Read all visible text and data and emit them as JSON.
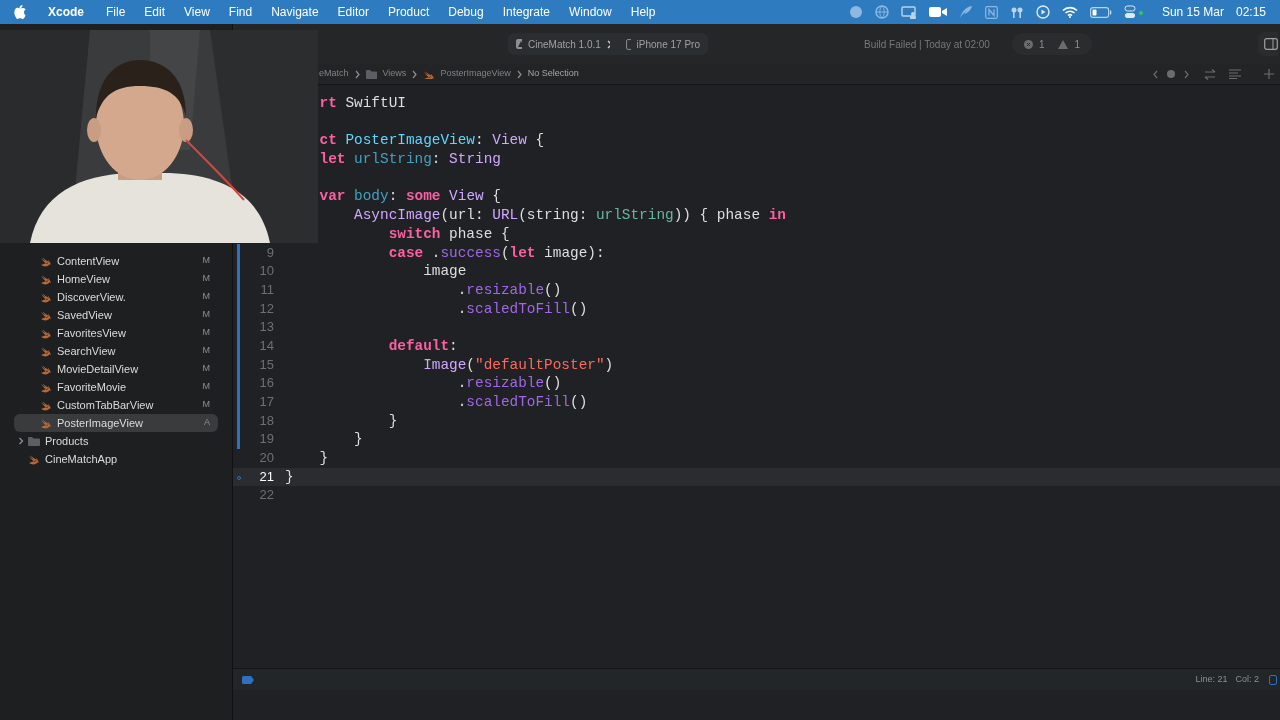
{
  "menu_bar": {
    "app_name": "Xcode",
    "menus": [
      "File",
      "Edit",
      "View",
      "Find",
      "Navigate",
      "Editor",
      "Product",
      "Debug",
      "Integrate",
      "Window",
      "Help"
    ],
    "date": "Sun 15 Mar",
    "time": "02:15"
  },
  "toolbar": {
    "scheme": "CineMatch 1.0.1",
    "device": "iPhone 17 Pro",
    "build_status": "Build Failed | Today at 02:00",
    "errors": "1",
    "warnings": "1"
  },
  "navigator": {
    "items": [
      {
        "children": [
          {
            "name": "ContentView",
            "kind": "swift",
            "badge": "M",
            "selected": false
          },
          {
            "name": "HomeView",
            "kind": "swift",
            "badge": "M",
            "selected": false
          },
          {
            "name": "DiscoverView.",
            "kind": "swift",
            "badge": "M",
            "selected": false
          },
          {
            "name": "SavedView",
            "kind": "swift",
            "badge": "M",
            "selected": false
          },
          {
            "name": "FavoritesView",
            "kind": "swift",
            "badge": "M",
            "selected": false
          },
          {
            "name": "SearchView",
            "kind": "swift",
            "badge": "M",
            "selected": false
          },
          {
            "name": "MovieDetailView",
            "kind": "swift",
            "badge": "M",
            "selected": false
          },
          {
            "name": "FavoriteMovie",
            "kind": "swift",
            "badge": "M",
            "selected": false
          },
          {
            "name": "CustomTabBarView",
            "kind": "swift",
            "badge": "M",
            "selected": false
          },
          {
            "name": "PosterImageView",
            "kind": "swift",
            "badge": "A",
            "selected": true
          }
        ]
      },
      {
        "name": "Products",
        "kind": "folder",
        "expanded": false,
        "selected": false
      },
      {
        "name": "CineMatchApp",
        "kind": "swift",
        "selected": false
      }
    ]
  },
  "jump_bar": [
    {
      "text": "eMatch",
      "kind": "project"
    },
    {
      "text": "Views",
      "kind": "folder"
    },
    {
      "text": "PosterImageView",
      "kind": "swift"
    },
    {
      "text": "No Selection",
      "kind": "symbol"
    }
  ],
  "editor": {
    "lines": [
      {
        "kind": "code",
        "tokens": [
          {
            "kind": "keyword",
            "text": "    rt"
          },
          {
            "kind": "plain",
            "text": " SwiftUI"
          }
        ]
      },
      {
        "kind": "blank"
      },
      {
        "kind": "code",
        "tokens": [
          {
            "kind": "keyword",
            "text": "    ct "
          },
          {
            "kind": "decl_type",
            "text": "PosterImageView"
          },
          {
            "kind": "plain",
            "text": ": "
          },
          {
            "kind": "type",
            "text": "View"
          },
          {
            "kind": "plain",
            "text": " {"
          }
        ]
      },
      {
        "kind": "code",
        "tokens": [
          {
            "kind": "keyword",
            "text": "    let "
          },
          {
            "kind": "decl",
            "text": "urlString"
          },
          {
            "kind": "plain",
            "text": ": "
          },
          {
            "kind": "type",
            "text": "String"
          }
        ]
      },
      {
        "kind": "blank"
      },
      {
        "kind": "code",
        "tokens": [
          {
            "kind": "keyword",
            "text": "    var "
          },
          {
            "kind": "decl",
            "text": "body"
          },
          {
            "kind": "plain",
            "text": ": "
          },
          {
            "kind": "keyword",
            "text": "some "
          },
          {
            "kind": "type",
            "text": "View"
          },
          {
            "kind": "plain",
            "text": " {"
          }
        ]
      },
      {
        "kind": "code",
        "tokens": [
          {
            "kind": "type",
            "text": "        AsyncImage"
          },
          {
            "kind": "plain",
            "text": "(url: "
          },
          {
            "kind": "type",
            "text": "URL"
          },
          {
            "kind": "plain",
            "text": "(string: "
          },
          {
            "kind": "ref",
            "text": "urlString"
          },
          {
            "kind": "plain",
            "text": ")) { phase "
          },
          {
            "kind": "keyword",
            "text": "in"
          }
        ]
      },
      {
        "kind": "code",
        "tokens": [
          {
            "kind": "keyword",
            "text": "            switch"
          },
          {
            "kind": "plain",
            "text": " phase {"
          }
        ]
      },
      {
        "number": "9",
        "changed": true,
        "tokens": [
          {
            "kind": "keyword",
            "text": "            case"
          },
          {
            "kind": "plain",
            "text": " ."
          },
          {
            "kind": "member",
            "text": "success"
          },
          {
            "kind": "plain",
            "text": "("
          },
          {
            "kind": "keyword",
            "text": "let"
          },
          {
            "kind": "plain",
            "text": " image):"
          }
        ]
      },
      {
        "number": "10",
        "changed": true,
        "tokens": [
          {
            "kind": "plain",
            "text": "                image"
          }
        ]
      },
      {
        "number": "11",
        "changed": true,
        "tokens": [
          {
            "kind": "plain",
            "text": "                    ."
          },
          {
            "kind": "member",
            "text": "resizable"
          },
          {
            "kind": "plain",
            "text": "()"
          }
        ]
      },
      {
        "number": "12",
        "changed": true,
        "tokens": [
          {
            "kind": "plain",
            "text": "                    ."
          },
          {
            "kind": "member",
            "text": "scaledToFill"
          },
          {
            "kind": "plain",
            "text": "()"
          }
        ]
      },
      {
        "number": "13",
        "changed": true
      },
      {
        "number": "14",
        "changed": true,
        "tokens": [
          {
            "kind": "keyword",
            "text": "            default"
          },
          {
            "kind": "plain",
            "text": ":"
          }
        ]
      },
      {
        "number": "15",
        "changed": true,
        "tokens": [
          {
            "kind": "type",
            "text": "                Image"
          },
          {
            "kind": "plain",
            "text": "("
          },
          {
            "kind": "string",
            "text": "\"defaultPoster\""
          },
          {
            "kind": "plain",
            "text": ")"
          }
        ]
      },
      {
        "number": "16",
        "changed": true,
        "tokens": [
          {
            "kind": "plain",
            "text": "                    ."
          },
          {
            "kind": "member",
            "text": "resizable"
          },
          {
            "kind": "plain",
            "text": "()"
          }
        ]
      },
      {
        "number": "17",
        "changed": true,
        "tokens": [
          {
            "kind": "plain",
            "text": "                    ."
          },
          {
            "kind": "member",
            "text": "scaledToFill"
          },
          {
            "kind": "plain",
            "text": "()"
          }
        ]
      },
      {
        "number": "18",
        "changed": true,
        "tokens": [
          {
            "kind": "plain",
            "text": "            }"
          }
        ]
      },
      {
        "number": "19",
        "changed": true,
        "tokens": [
          {
            "kind": "plain",
            "text": "        }"
          }
        ]
      },
      {
        "number": "20",
        "tokens": [
          {
            "kind": "plain",
            "text": "    }"
          }
        ]
      },
      {
        "number": "21",
        "current": true,
        "tokens": [
          {
            "kind": "plain",
            "text": "}"
          }
        ]
      },
      {
        "number": "22"
      }
    ]
  },
  "status_bar": {
    "line": "Line: 21",
    "column": "Col: 2"
  }
}
